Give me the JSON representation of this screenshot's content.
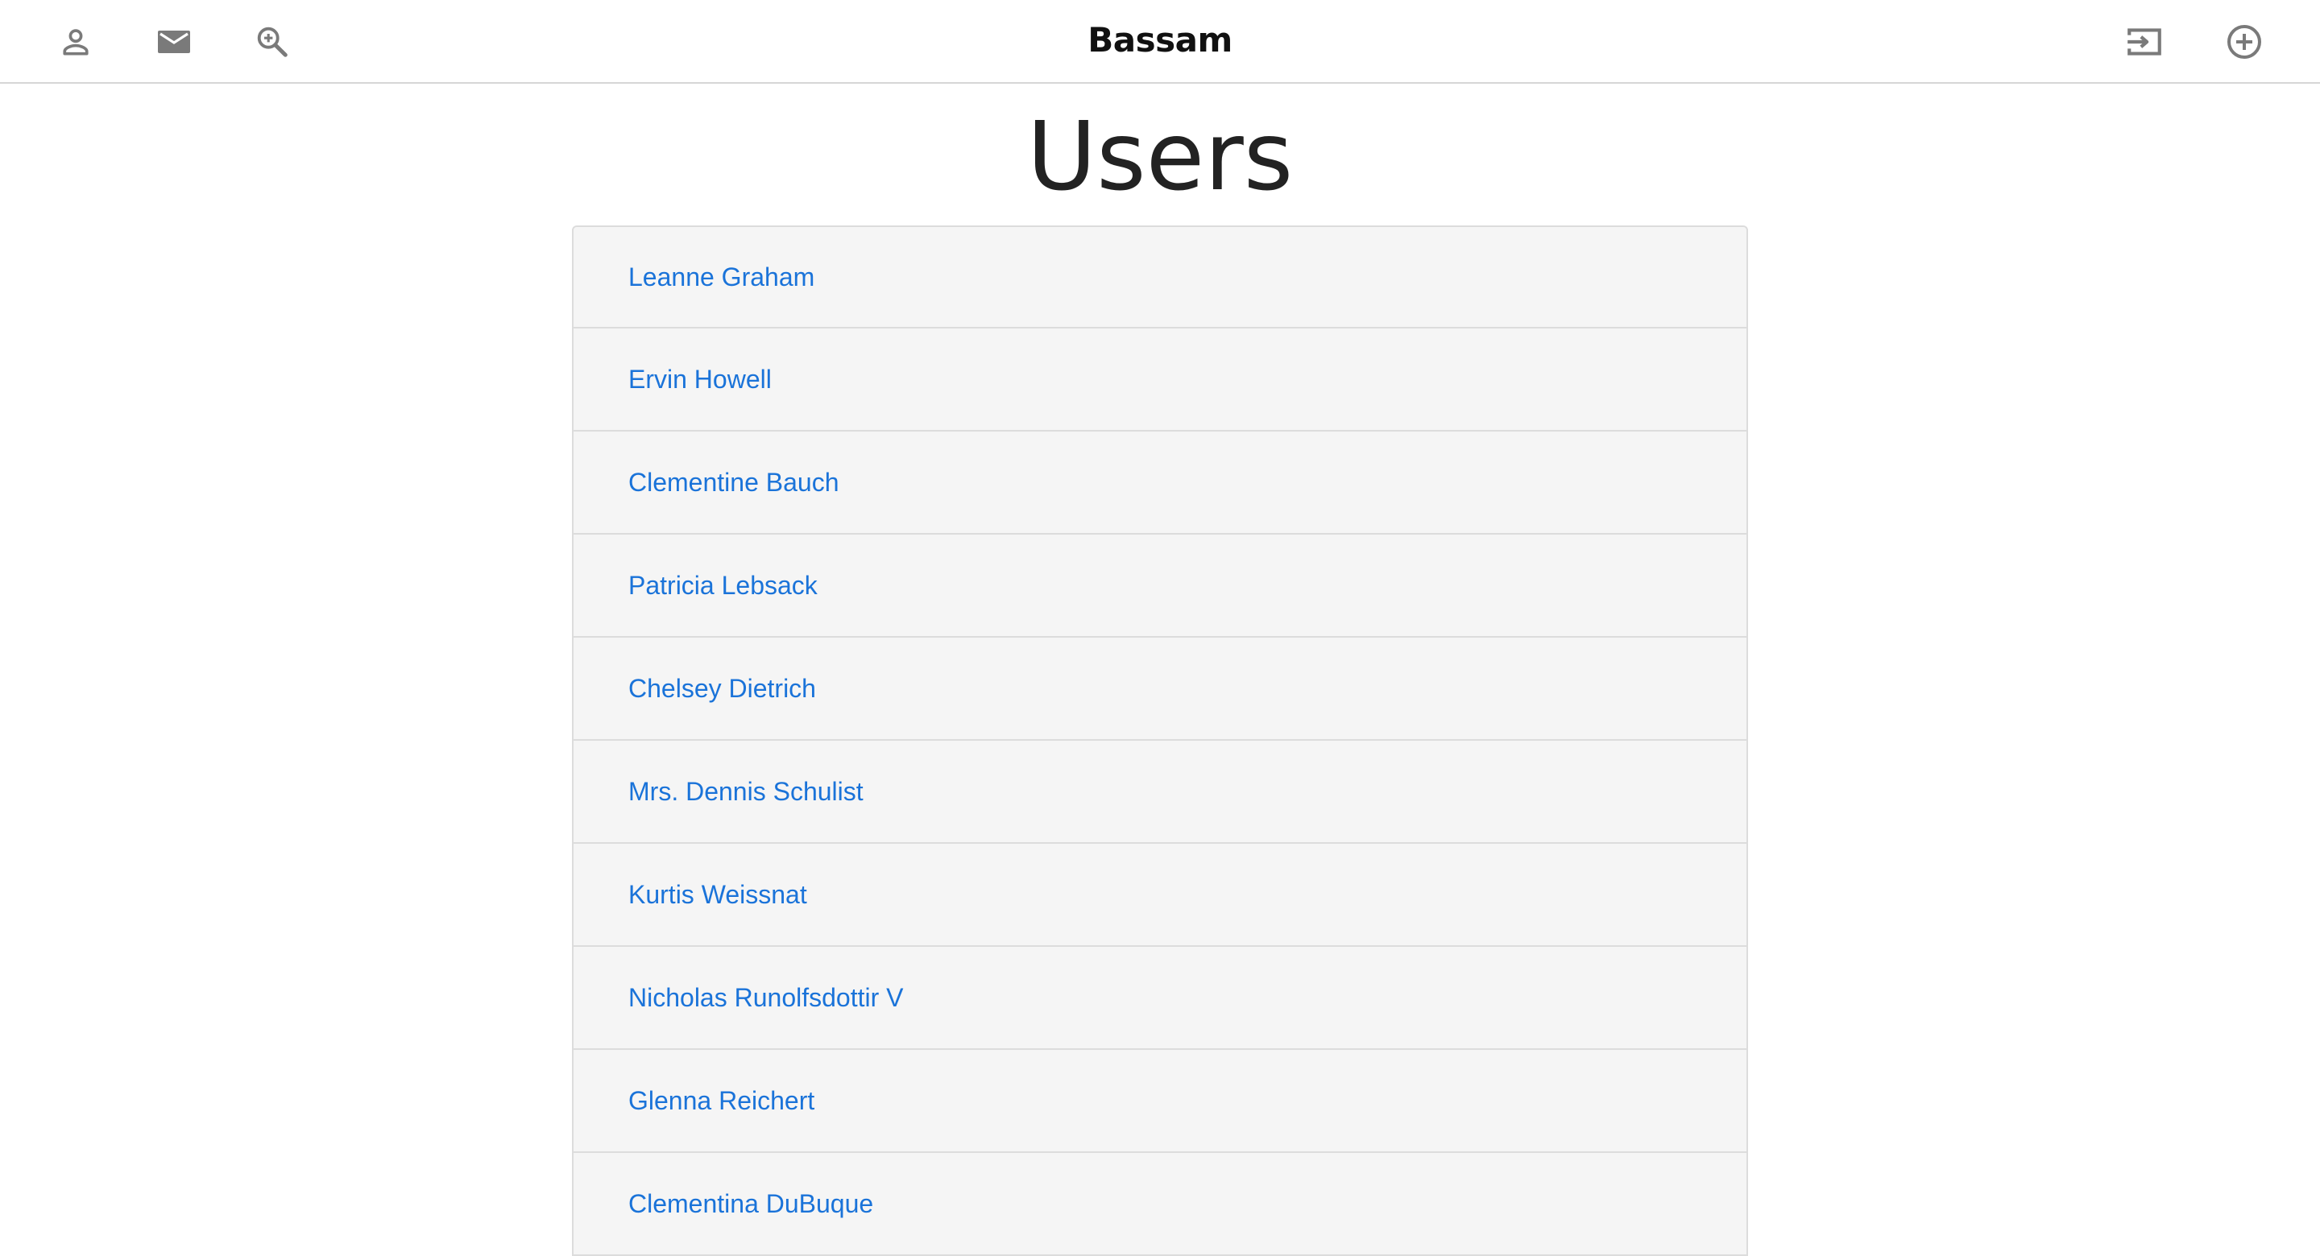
{
  "navbar": {
    "brand": "Bassam",
    "left_icons": [
      "person-icon",
      "mail-icon",
      "zoom-in-icon"
    ],
    "right_icons": [
      "login-icon",
      "add-circle-icon"
    ],
    "icon_color": "#7a7a7a"
  },
  "page": {
    "title": "Users"
  },
  "users": [
    {
      "name": "Leanne Graham"
    },
    {
      "name": "Ervin Howell"
    },
    {
      "name": "Clementine Bauch"
    },
    {
      "name": "Patricia Lebsack"
    },
    {
      "name": "Chelsey Dietrich"
    },
    {
      "name": "Mrs. Dennis Schulist"
    },
    {
      "name": "Kurtis Weissnat"
    },
    {
      "name": "Nicholas Runolfsdottir V"
    },
    {
      "name": "Glenna Reichert"
    },
    {
      "name": "Clementina DuBuque"
    }
  ],
  "colors": {
    "link": "#1a73d9",
    "list_background": "#f5f5f5",
    "border": "#dcdcdc"
  }
}
